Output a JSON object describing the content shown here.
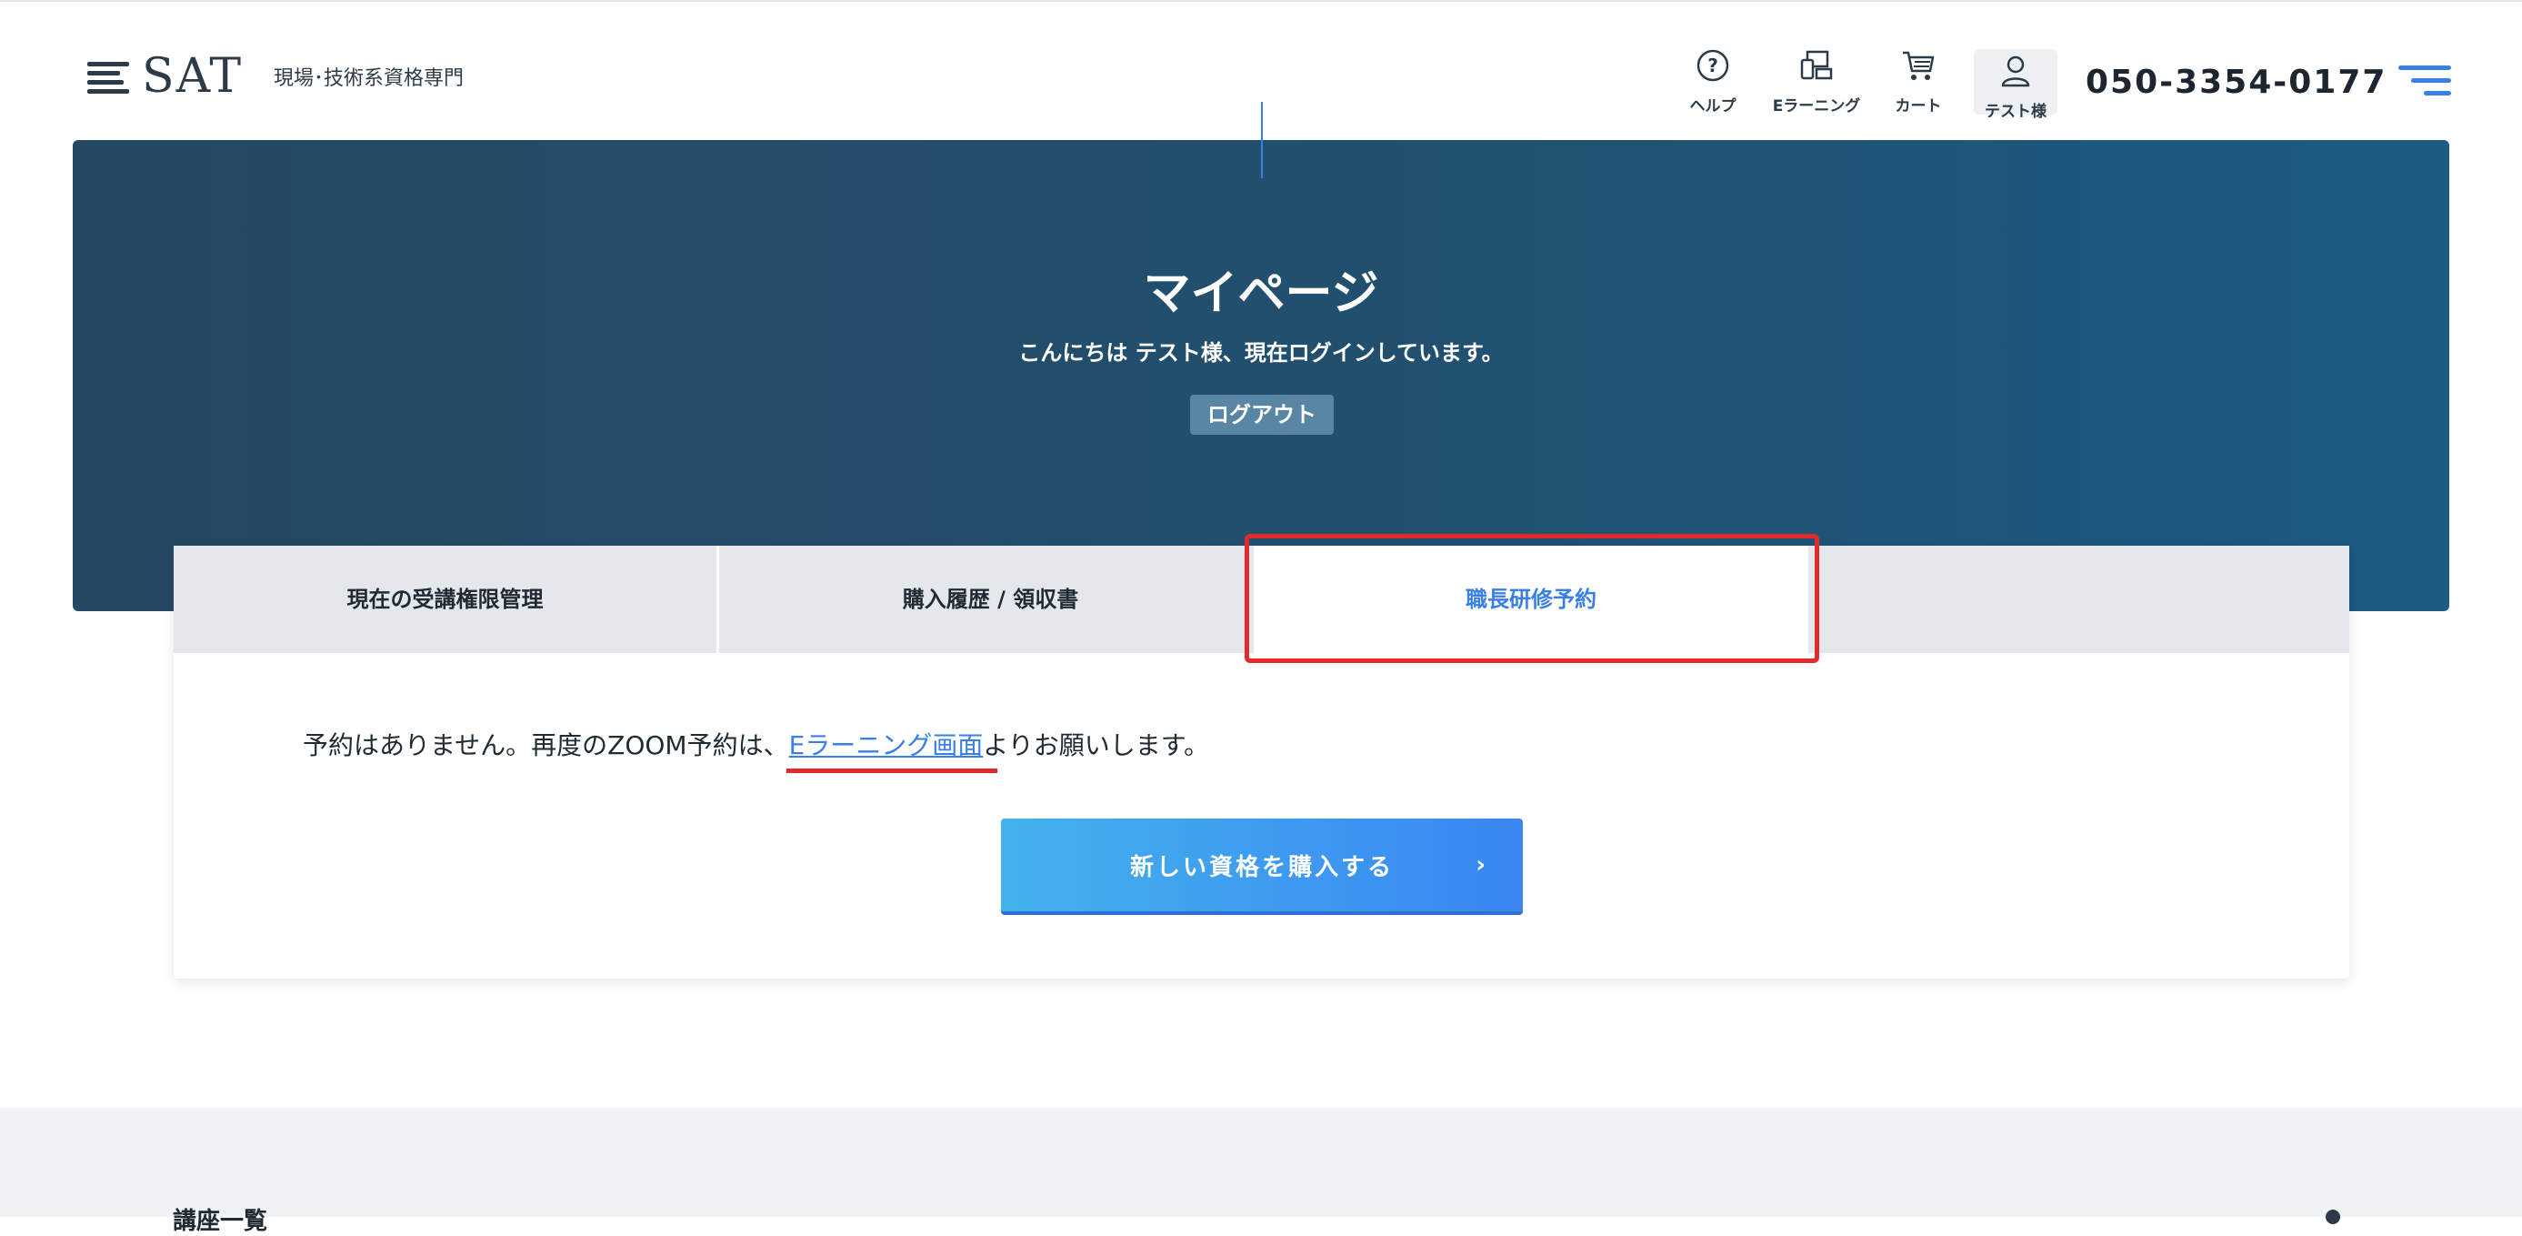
{
  "header": {
    "logo": "SAT",
    "tagline": "現場･技術系資格専門",
    "nav": [
      {
        "label": "ヘルプ",
        "icon": "help-icon"
      },
      {
        "label": "Eラーニング",
        "icon": "devices-icon"
      },
      {
        "label": "カート",
        "icon": "cart-icon"
      },
      {
        "label": "テスト様",
        "icon": "user-icon"
      }
    ],
    "phone": "050-3354-0177"
  },
  "hero": {
    "title": "マイページ",
    "subtitle": "こんにちは テスト様、現在ログインしています。",
    "logout_label": "ログアウト"
  },
  "tabs": [
    {
      "label": "現在の受講権限管理"
    },
    {
      "label": "購入履歴 / 領収書"
    },
    {
      "label": "職長研修予約",
      "active": true
    }
  ],
  "content": {
    "message_before": "予約はありません。再度のZOOM予約は、",
    "message_link": "Eラーニング画面",
    "message_after": "よりお願いします。",
    "buy_button_label": "新しい資格を購入する",
    "buy_button_arrow": "›"
  },
  "footer": {
    "partial_heading": "講座一覧"
  },
  "colors": {
    "accent": "#3a7fe6",
    "highlight": "#e22a2a",
    "hero_start": "#264862",
    "hero_end": "#1d5a82"
  }
}
